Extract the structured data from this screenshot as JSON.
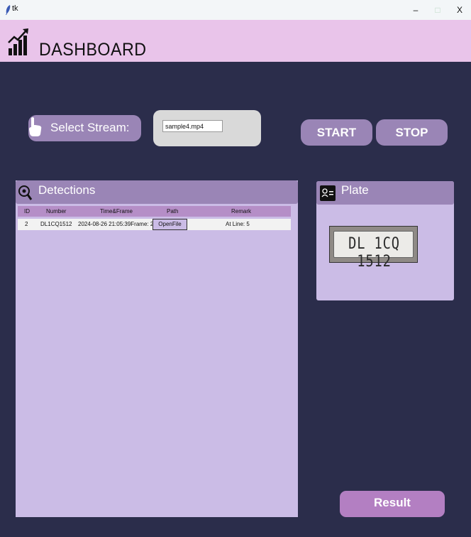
{
  "window": {
    "title": "tk",
    "minimize_glyph": "–",
    "maximize_glyph": "□",
    "close_glyph": "X"
  },
  "header": {
    "title": "DASHBOARD",
    "icon": "bar-chart-trend-icon"
  },
  "stream": {
    "label": "Select Stream:",
    "icon": "hand-pointer-icon",
    "input_value": "sample4.mp4"
  },
  "controls": {
    "start_label": "START",
    "stop_label": "STOP"
  },
  "detections": {
    "title": "Detections",
    "icon": "magnifier-icon",
    "columns": [
      "ID",
      "Number",
      "Time&Frame",
      "Path",
      "Remark"
    ],
    "rows": [
      {
        "id": "2",
        "number": "DL1CQ1512",
        "time_frame": "2024-08-26 21:05:39Frame: 2",
        "path_button": "OpenFile",
        "remark": "At Line: 5"
      }
    ]
  },
  "plate": {
    "title": "Plate",
    "icon": "id-card-icon",
    "plate_text": "DL 1CQ 1512"
  },
  "result_label": "Result",
  "colors": {
    "background": "#2b2d4b",
    "header": "#e9c4ea",
    "button": "#9a85b6",
    "panel": "#cbbce6",
    "table_header": "#b58ec7",
    "result_button": "#b37fc2"
  }
}
